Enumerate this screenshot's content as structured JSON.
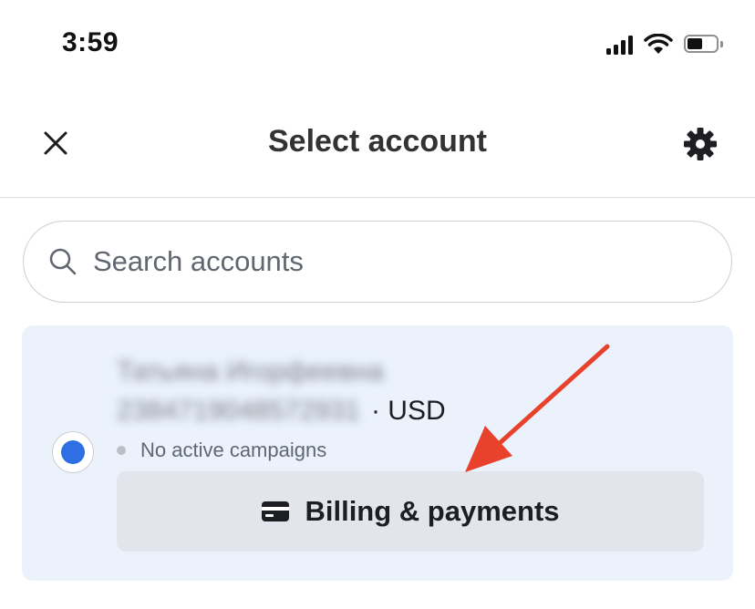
{
  "status_bar": {
    "time": "3:59"
  },
  "header": {
    "title": "Select account",
    "close_icon": "close-icon",
    "settings_icon": "gear-icon"
  },
  "search": {
    "placeholder": "Search accounts",
    "value": ""
  },
  "account": {
    "name": "Татьяна Игорфеевна",
    "account_id": "2384719048572931",
    "currency": "· USD",
    "status": "No active campaigns",
    "selected": true,
    "billing_label": "Billing & payments",
    "billing_icon": "credit-card-icon"
  },
  "colors": {
    "accent": "#2f6fe4",
    "card_background": "#ebf2fc",
    "annotation_arrow": "#e8412c"
  }
}
